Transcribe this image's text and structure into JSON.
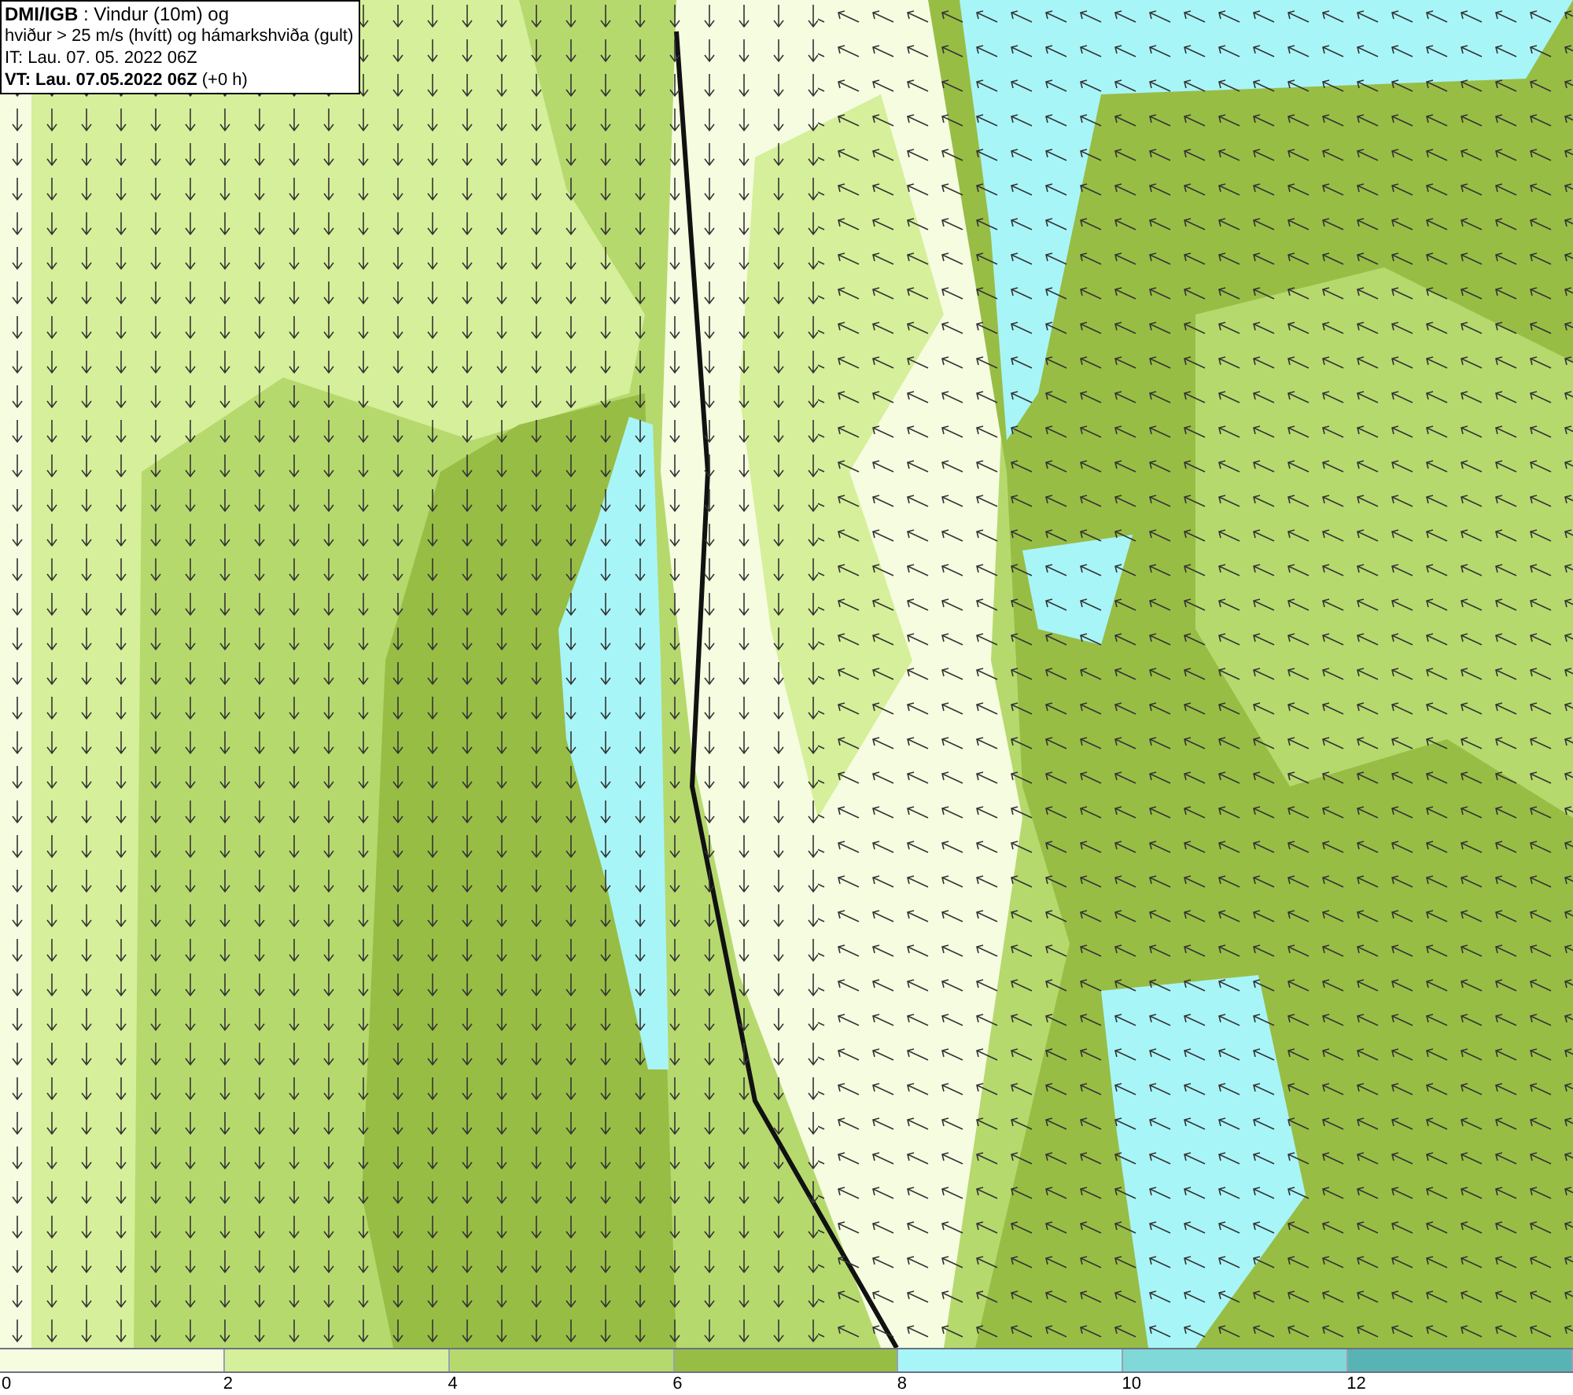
{
  "title_box": {
    "lines": [
      "**DMI/IGB** : Vindur (10m) og",
      "hviður > 25 m/s (hvítt) og hámarkshviða (gult)",
      "IT: Lau. 07. 05. 2022 06Z",
      "**VT: Lau. 07.05.2022 06Z** (+0 h)"
    ]
  },
  "legend": {
    "bins": [
      {
        "color": "#f5fce0"
      },
      {
        "color": "#d6ef9a"
      },
      {
        "color": "#b6d96e"
      },
      {
        "color": "#98bd45"
      },
      {
        "color": "#a8f5f8"
      },
      {
        "color": "#80d8d8"
      },
      {
        "color": "#58b4b4"
      }
    ],
    "labels": [
      "0",
      "2",
      "4",
      "6",
      "8",
      "10",
      "12"
    ]
  }
}
